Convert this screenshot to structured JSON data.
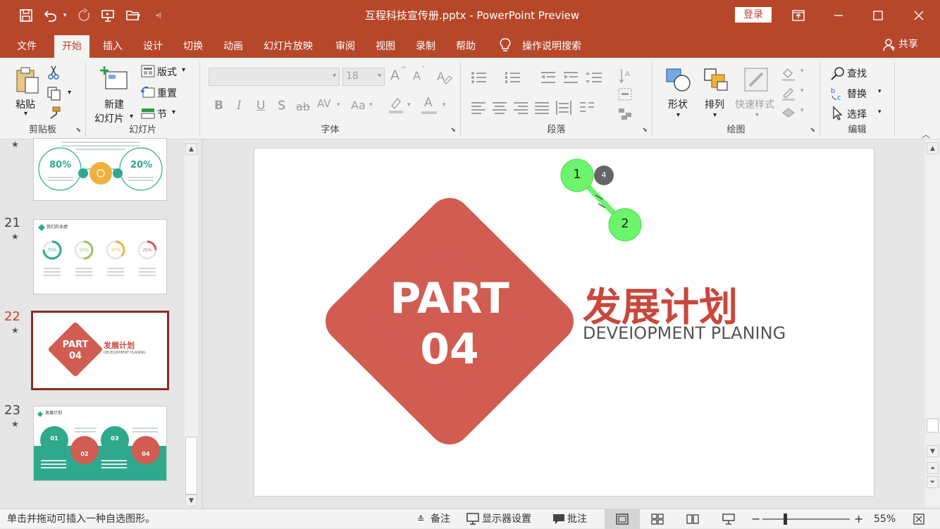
{
  "window": {
    "title": "互程科技宣传册.pptx  -  PowerPoint Preview",
    "login": "登录"
  },
  "tabs": [
    {
      "label": "文件"
    },
    {
      "label": "开始"
    },
    {
      "label": "插入"
    },
    {
      "label": "设计"
    },
    {
      "label": "切换"
    },
    {
      "label": "动画"
    },
    {
      "label": "幻灯片放映"
    },
    {
      "label": "审阅"
    },
    {
      "label": "视图"
    },
    {
      "label": "录制"
    },
    {
      "label": "帮助"
    },
    {
      "label": "操作说明搜索"
    }
  ],
  "share": "共享",
  "ribbon": {
    "clipboard": {
      "label": "剪贴板",
      "paste": "粘贴"
    },
    "slides": {
      "label": "幻灯片",
      "new_slide_1": "新建",
      "new_slide_2": "幻灯片",
      "layout": "版式",
      "reset": "重置",
      "section": "节"
    },
    "font": {
      "label": "字体",
      "size": "18",
      "bold": "B",
      "italic": "I",
      "underline": "U",
      "shadow": "S",
      "strike": "ab",
      "spacing": "AV",
      "case": "Aa",
      "grow": "A",
      "shrink": "A",
      "color": "A"
    },
    "paragraph": {
      "label": "段落"
    },
    "drawing": {
      "label": "绘图",
      "shapes": "形状",
      "arrange": "排列",
      "quick_styles": "快速样式"
    },
    "editing": {
      "label": "编辑",
      "find": "查找",
      "replace": "替换",
      "select": "选择"
    }
  },
  "thumbnails": {
    "slide20": {
      "left_pct": "80%",
      "right_pct": "20%"
    },
    "slide21": {
      "num": "21",
      "title": "我们的业绩",
      "values": [
        "75%",
        "50%",
        "37%",
        "25%"
      ],
      "progress": [
        0.75,
        0.5,
        0.37,
        0.25
      ]
    },
    "slide22": {
      "num": "22",
      "part": "PART",
      "part_num": "04",
      "title": "发展计划",
      "subtitle": "DEVEIOPMENT PLANING"
    },
    "slide23": {
      "num": "23",
      "title": "发展计划",
      "steps": [
        "01",
        "02",
        "03",
        "04"
      ]
    }
  },
  "slide": {
    "part": "PART",
    "part_num": "04",
    "title": "发展计划",
    "subtitle": "DEVEIOPMENT PLANING",
    "markers": {
      "m1": "1",
      "m2": "2",
      "m4": "4"
    }
  },
  "status": {
    "hint": "单击并拖动可插入一种自选图形。",
    "notes": "备注",
    "display": "显示器设置",
    "comments": "批注",
    "zoom": "55%"
  },
  "colors": {
    "brand": "#b7472a",
    "diamond": "#d05c52",
    "title_red": "#c9473b",
    "teal": "#2fa98e",
    "marker_green": "#6cf56c"
  }
}
